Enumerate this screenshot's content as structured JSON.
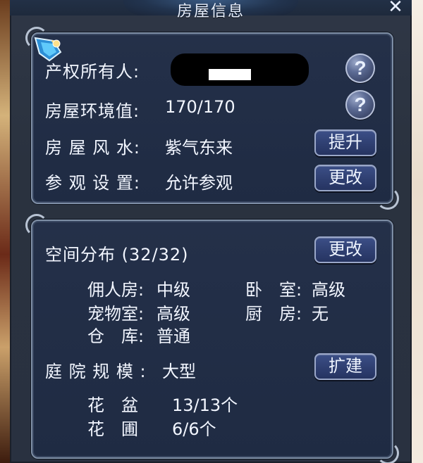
{
  "window": {
    "title": "房屋信息",
    "close_label": "✕"
  },
  "panel_info": {
    "owner_label": "产权所有人:",
    "owner_value_redacted": "",
    "env_label": "房屋环境值:",
    "env_value": "170/170",
    "fengshui_label": "房 屋 风 水:",
    "fengshui_value": "紫气东来",
    "fengshui_button": "提升",
    "visit_label": "参 观 设 置:",
    "visit_value": "允许参观",
    "visit_button": "更改",
    "help_label": "?"
  },
  "panel_space": {
    "space_label": "空间分布 (32/32)",
    "space_button": "更改",
    "rooms": [
      {
        "label": "佣人房:",
        "value": "中级"
      },
      {
        "label": "卧　室:",
        "value": "高级"
      },
      {
        "label": "宠物室:",
        "value": "高级"
      },
      {
        "label": "厨　房:",
        "value": "无"
      },
      {
        "label": "仓　库:",
        "value": "普通"
      }
    ],
    "yard_label": "庭 院 规 模 :",
    "yard_value": "大型",
    "yard_button": "扩建",
    "flower_pot_label": "花　盆",
    "flower_pot_value": "13/13个",
    "garden_label": "花　圃",
    "garden_value": "6/6个"
  },
  "colors": {
    "panel_bg": "#243049",
    "button_blue": "#2f3f71",
    "text": "#f2f6ff"
  },
  "icons": {
    "help_icon": "question-circle",
    "decor_icon": "feather-crystal",
    "close_icon": "close"
  }
}
